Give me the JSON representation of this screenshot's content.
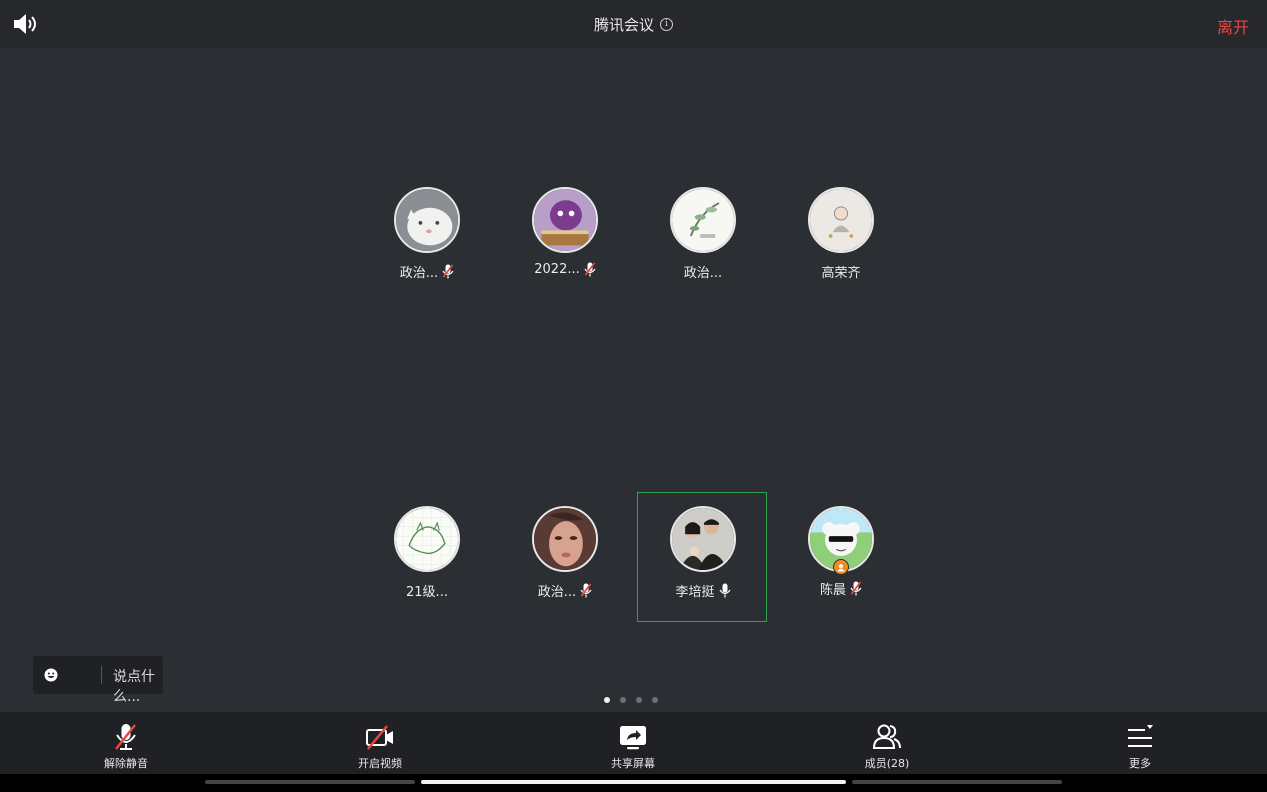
{
  "header": {
    "title": "腾讯会议",
    "info_glyph": "i",
    "leave_label": "离开",
    "speaker_icon": "speaker-icon"
  },
  "participants": [
    {
      "name": "政治...",
      "mic": "muted",
      "avatar": "white-cat"
    },
    {
      "name": "2022...",
      "mic": "muted",
      "avatar": "purple-toy"
    },
    {
      "name": "政治...",
      "mic": "none",
      "avatar": "ink-plant"
    },
    {
      "name": "高荣齐",
      "mic": "none",
      "avatar": "little-monk"
    },
    {
      "name": "21级...",
      "mic": "none",
      "avatar": "green-sketch"
    },
    {
      "name": "政治...",
      "mic": "muted",
      "avatar": "woman-face"
    },
    {
      "name": "李培挺",
      "mic": "active",
      "avatar": "couple-photo",
      "highlighted": true
    },
    {
      "name": "陈晨",
      "mic": "muted",
      "avatar": "sheep-sunglasses",
      "badge": "host-icon"
    }
  ],
  "chat": {
    "placeholder": "说点什么...",
    "icon": "emoji-icon"
  },
  "pagination": {
    "pages": 4,
    "current": 1
  },
  "toolbar": {
    "unmute_label": "解除静音",
    "video_label": "开启视频",
    "share_label": "共享屏幕",
    "members_label": "成员(28)",
    "more_label": "更多"
  },
  "colors": {
    "background": "#2b2e33",
    "bar": "#1f2125",
    "leave": "#e5483f",
    "active_border": "#2ea34a",
    "muted_mic": "#e5483f"
  }
}
